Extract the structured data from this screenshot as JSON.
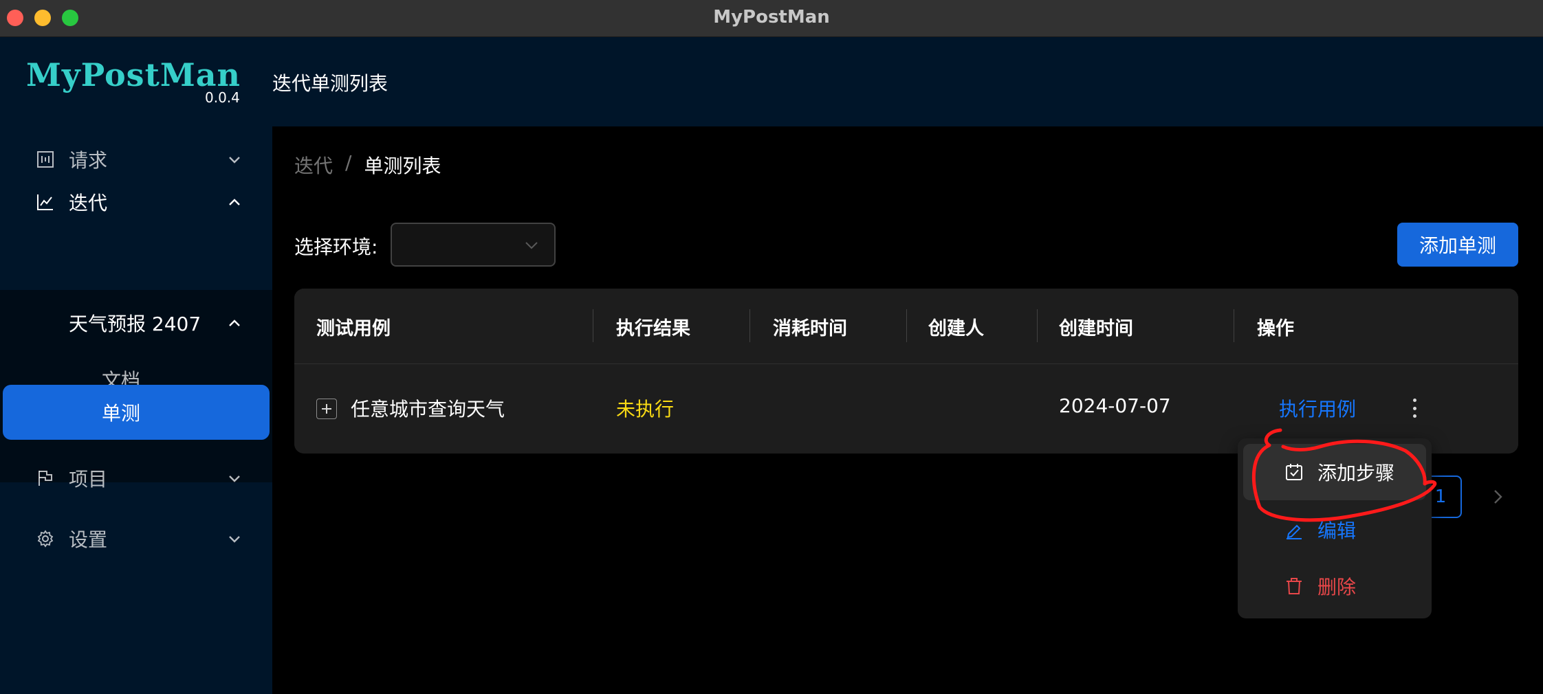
{
  "window": {
    "title": "MyPostMan"
  },
  "sidebar": {
    "logo": "MyPostMan",
    "version": "0.0.4",
    "items": [
      {
        "label": "请求",
        "icon": "request-icon",
        "expanded": false
      },
      {
        "label": "迭代",
        "icon": "chart-line-icon",
        "expanded": true
      },
      {
        "label": "项目",
        "icon": "flag-icon",
        "expanded": false
      },
      {
        "label": "设置",
        "icon": "gear-icon",
        "expanded": false
      }
    ],
    "sub_group": {
      "label": "天气预报 2407",
      "expanded": true
    },
    "sub_items": [
      {
        "label": "文档",
        "selected": false
      },
      {
        "label": "单测",
        "selected": true
      }
    ]
  },
  "header": {
    "title": "迭代单测列表"
  },
  "breadcrumb": {
    "parent": "迭代",
    "separator": "/",
    "current": "单测列表"
  },
  "toolbar": {
    "env_label": "选择环境:",
    "env_value": "",
    "add_button": "添加单测"
  },
  "table": {
    "columns": [
      "测试用例",
      "执行结果",
      "消耗时间",
      "创建人",
      "创建时间",
      "操作"
    ],
    "rows": [
      {
        "name": "任意城市查询天气",
        "result": "未执行",
        "duration": "",
        "creator": "",
        "created": "2024-07-07",
        "action": "执行用例"
      }
    ]
  },
  "pagination": {
    "current": "1"
  },
  "dropdown": {
    "items": [
      {
        "label": "添加步骤",
        "icon": "calendar-check-icon"
      },
      {
        "label": "编辑",
        "icon": "edit-icon"
      },
      {
        "label": "删除",
        "icon": "delete-icon"
      }
    ]
  },
  "colors": {
    "sidebar_bg": "#001529",
    "primary": "#1668dc",
    "link": "#1677ff",
    "danger": "#e84749",
    "warning": "#fadb14",
    "logo": "#36cfc9",
    "annotation": "#ff1a1a"
  }
}
